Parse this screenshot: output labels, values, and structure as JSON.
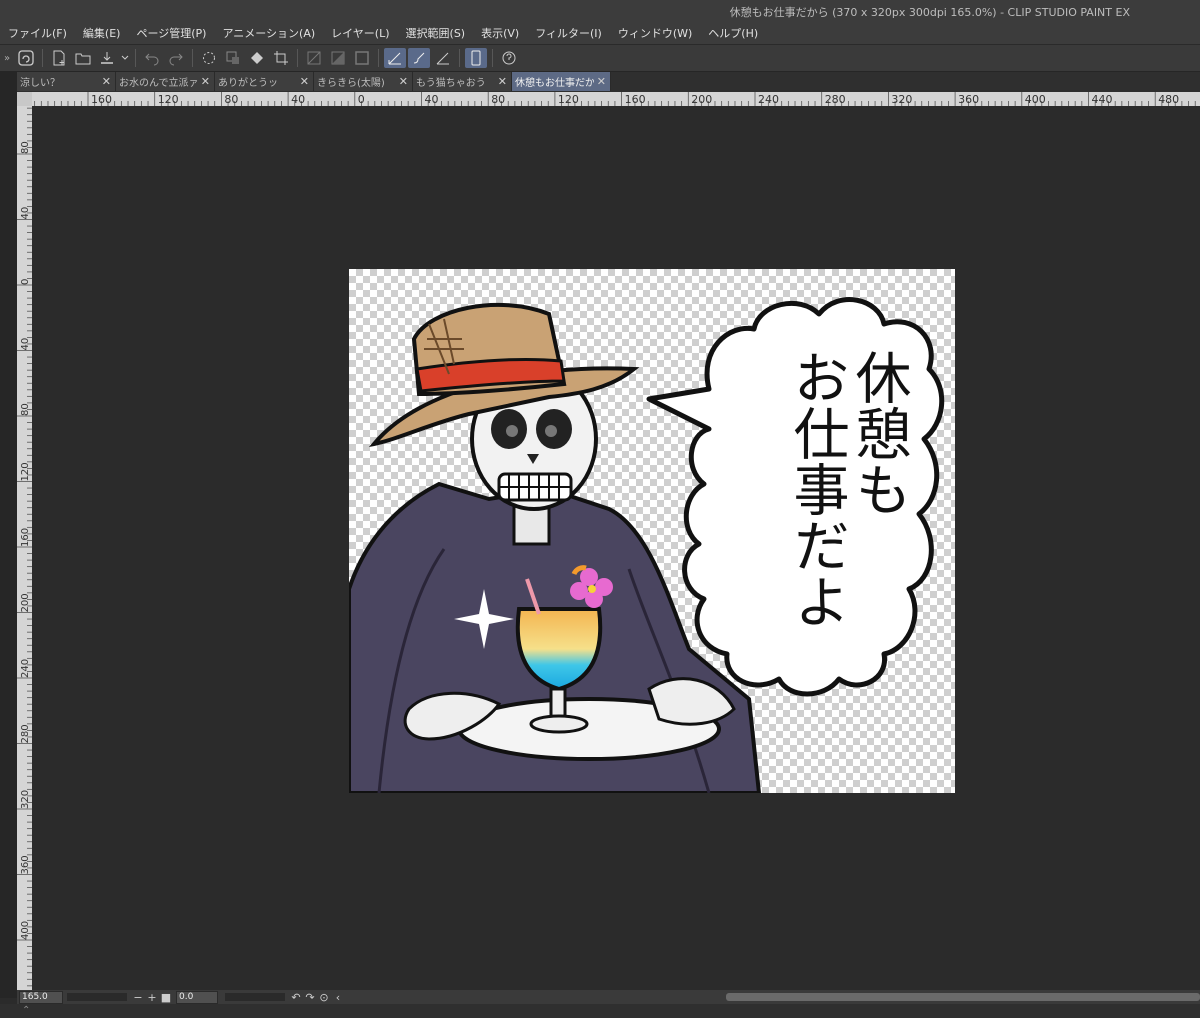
{
  "window": {
    "title": "休憩もお仕事だから (370 x 320px 300dpi 165.0%)  - CLIP STUDIO PAINT EX"
  },
  "menu": {
    "items": [
      "ファイル(F)",
      "編集(E)",
      "ページ管理(P)",
      "アニメーション(A)",
      "レイヤー(L)",
      "選択範囲(S)",
      "表示(V)",
      "フィルター(I)",
      "ウィンドウ(W)",
      "ヘルプ(H)"
    ]
  },
  "toolbar": {
    "icons": [
      "clip-studio-icon",
      "new-file-icon",
      "open-folder-icon",
      "save-icon",
      "undo-icon",
      "redo-icon",
      "loading-icon",
      "transform-icon",
      "fill-icon",
      "crop-icon",
      "clear-icon",
      "shade-icon",
      "frame-icon",
      "pen-icon",
      "brush-icon",
      "ruler-icon",
      "tablet-icon",
      "help-icon"
    ]
  },
  "tabs": [
    {
      "label": "涼しい？",
      "active": false
    },
    {
      "label": "お水のんで立派ァ",
      "active": false
    },
    {
      "label": "ありがとうッ",
      "active": false
    },
    {
      "label": "きらきら(太陽)",
      "active": false
    },
    {
      "label": "もう猫ちゃおう",
      "active": false
    },
    {
      "label": "休憩もお仕事だから",
      "active": true
    }
  ],
  "rulers": {
    "horizontal": [
      "160",
      "120",
      "80",
      "40",
      "0",
      "40",
      "80",
      "120",
      "160",
      "200",
      "240",
      "280",
      "320",
      "360",
      "400",
      "440",
      "480"
    ],
    "vertical": [
      "80",
      "40",
      "0",
      "40",
      "80",
      "120",
      "160",
      "200",
      "240",
      "280",
      "320",
      "360",
      "400"
    ]
  },
  "canvas": {
    "speech_lines": [
      "休憩も",
      "お仕事だよ"
    ]
  },
  "status": {
    "zoom": "165.0",
    "angle": "0.0"
  },
  "colors": {
    "accent": "#5d6a85",
    "background": "#2b2b2b",
    "ruler": "#d5d5d5"
  }
}
